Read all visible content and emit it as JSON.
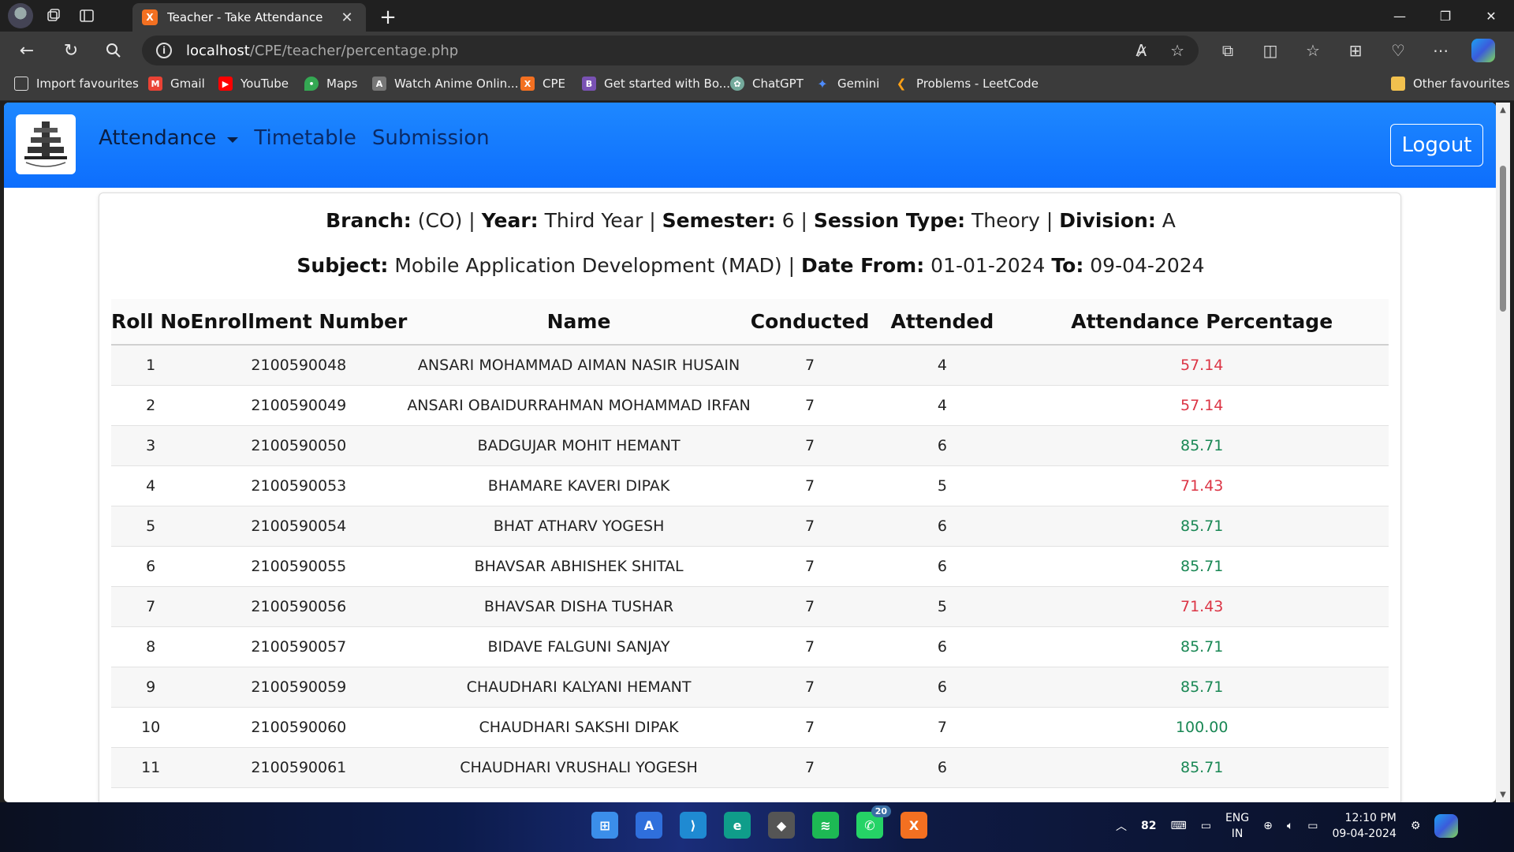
{
  "browser": {
    "tab_title": "Teacher - Take Attendance",
    "tab_favicon": "X",
    "url_host": "localhost",
    "url_path": "/CPE/teacher/percentage.php",
    "bookmarks": [
      {
        "label": "Import favourites",
        "icon": "import-icon",
        "color": "#5a5a5a"
      },
      {
        "label": "Gmail",
        "icon": "gmail-icon",
        "color": "#ea4335"
      },
      {
        "label": "YouTube",
        "icon": "youtube-icon",
        "color": "#ff0000"
      },
      {
        "label": "Maps",
        "icon": "maps-icon",
        "color": "#34a853"
      },
      {
        "label": "Watch Anime Onlin...",
        "icon": "anime-icon",
        "color": "#777777"
      },
      {
        "label": "CPE",
        "icon": "xampp-icon",
        "color": "#f37021"
      },
      {
        "label": "Get started with Bo...",
        "icon": "bootstrap-icon",
        "color": "#7952b3"
      },
      {
        "label": "ChatGPT",
        "icon": "chatgpt-icon",
        "color": "#74aa9c"
      },
      {
        "label": "Gemini",
        "icon": "gemini-icon",
        "color": "#4e8cff"
      },
      {
        "label": "Problems - LeetCode",
        "icon": "leetcode-icon",
        "color": "#ffa116"
      },
      {
        "label": "Other favourites",
        "icon": "folder-icon",
        "color": "#f2c14e"
      }
    ]
  },
  "navbar": {
    "links": [
      "Attendance",
      "Timetable",
      "Submission"
    ],
    "logout_label": "Logout"
  },
  "info": {
    "branch_label": "Branch:",
    "branch": "(CO)",
    "year_label": "Year:",
    "year": "Third Year",
    "semester_label": "Semester:",
    "semester": "6",
    "session_label": "Session Type:",
    "session": "Theory",
    "division_label": "Division:",
    "division": "A",
    "subject_label": "Subject:",
    "subject": "Mobile Application Development (MAD)",
    "from_label": "Date From:",
    "from": "01-01-2024",
    "to_label": "To:",
    "to": "09-04-2024"
  },
  "table": {
    "headers": [
      "Roll No",
      "Enrollment Number",
      "Name",
      "Conducted",
      "Attended",
      "Attendance Percentage"
    ],
    "rows": [
      {
        "roll": "1",
        "enroll": "2100590048",
        "name": "ANSARI MOHAMMAD AIMAN NASIR HUSAIN",
        "conducted": "7",
        "attended": "4",
        "pct": "57.14",
        "status": "low"
      },
      {
        "roll": "2",
        "enroll": "2100590049",
        "name": "ANSARI OBAIDURRAHMAN MOHAMMAD IRFAN",
        "conducted": "7",
        "attended": "4",
        "pct": "57.14",
        "status": "low"
      },
      {
        "roll": "3",
        "enroll": "2100590050",
        "name": "BADGUJAR MOHIT HEMANT",
        "conducted": "7",
        "attended": "6",
        "pct": "85.71",
        "status": "ok"
      },
      {
        "roll": "4",
        "enroll": "2100590053",
        "name": "BHAMARE KAVERI DIPAK",
        "conducted": "7",
        "attended": "5",
        "pct": "71.43",
        "status": "low"
      },
      {
        "roll": "5",
        "enroll": "2100590054",
        "name": "BHAT ATHARV YOGESH",
        "conducted": "7",
        "attended": "6",
        "pct": "85.71",
        "status": "ok"
      },
      {
        "roll": "6",
        "enroll": "2100590055",
        "name": "BHAVSAR ABHISHEK SHITAL",
        "conducted": "7",
        "attended": "6",
        "pct": "85.71",
        "status": "ok"
      },
      {
        "roll": "7",
        "enroll": "2100590056",
        "name": "BHAVSAR DISHA TUSHAR",
        "conducted": "7",
        "attended": "5",
        "pct": "71.43",
        "status": "low"
      },
      {
        "roll": "8",
        "enroll": "2100590057",
        "name": "BIDAVE FALGUNI SANJAY",
        "conducted": "7",
        "attended": "6",
        "pct": "85.71",
        "status": "ok"
      },
      {
        "roll": "9",
        "enroll": "2100590059",
        "name": "CHAUDHARI KALYANI HEMANT",
        "conducted": "7",
        "attended": "6",
        "pct": "85.71",
        "status": "ok"
      },
      {
        "roll": "10",
        "enroll": "2100590060",
        "name": "CHAUDHARI SAKSHI DIPAK",
        "conducted": "7",
        "attended": "7",
        "pct": "100.00",
        "status": "ok"
      },
      {
        "roll": "11",
        "enroll": "2100590061",
        "name": "CHAUDHARI VRUSHALI YOGESH",
        "conducted": "7",
        "attended": "6",
        "pct": "85.71",
        "status": "ok"
      }
    ]
  },
  "colors": {
    "navbar": "#0d6efd",
    "low_pct": "#dc3545",
    "ok_pct": "#198754"
  },
  "taskbar": {
    "apps": [
      {
        "name": "windows-start-icon",
        "color": "#3b8eea"
      },
      {
        "name": "app-store-icon",
        "color": "#2f6fdc"
      },
      {
        "name": "vscode-icon",
        "color": "#1f8ad2"
      },
      {
        "name": "edge-icon",
        "color": "#0f9d8a"
      },
      {
        "name": "unity-icon",
        "color": "#555555"
      },
      {
        "name": "spotify-icon",
        "color": "#1db954"
      },
      {
        "name": "whatsapp-icon",
        "color": "#25d366"
      },
      {
        "name": "xampp-icon",
        "color": "#f37021"
      }
    ],
    "whatsapp_badge": "20",
    "temp": "82",
    "lang": "ENG",
    "region": "IN",
    "time": "12:10 PM",
    "date": "09-04-2024"
  }
}
